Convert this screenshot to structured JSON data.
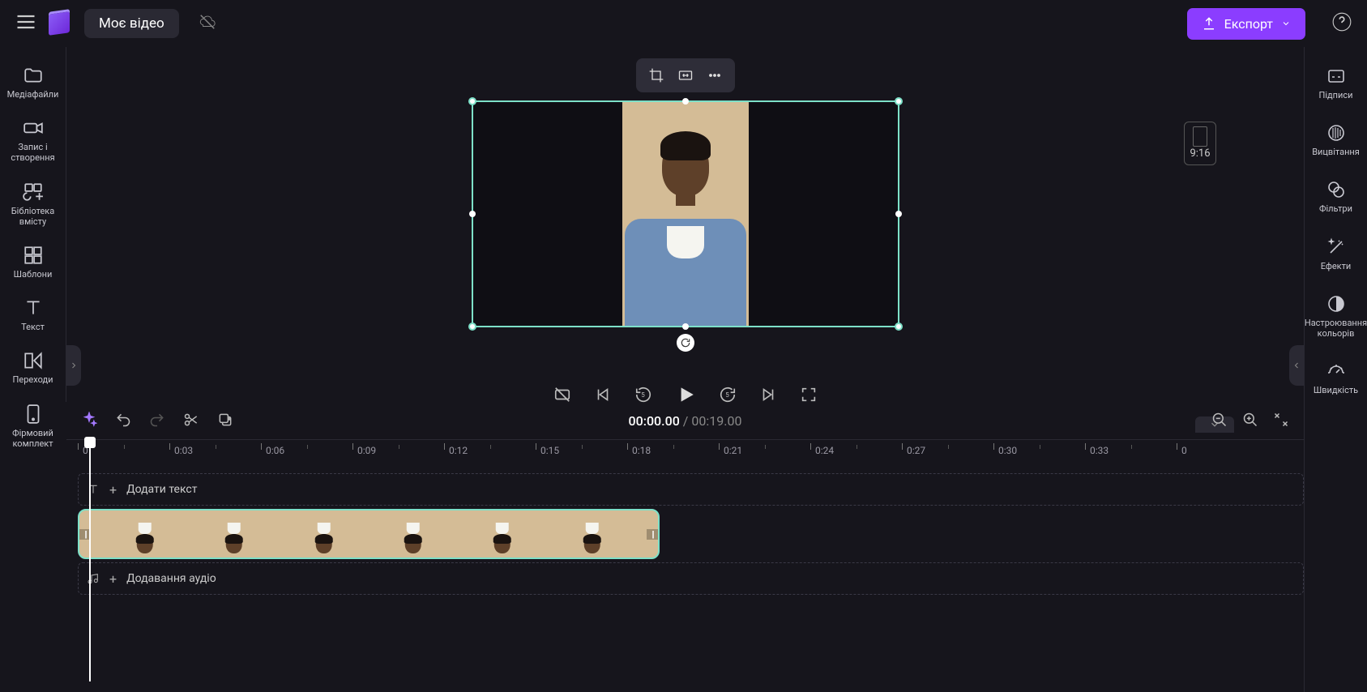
{
  "header": {
    "project_title": "Моє відео",
    "export_label": "Експорт"
  },
  "left_sidebar": {
    "media": "Медіафайли",
    "record": "Запис і створення",
    "library": "Бібліотека вмісту",
    "templates": "Шаблони",
    "text": "Текст",
    "transitions": "Переходи",
    "brandkit": "Фірмовий комплект"
  },
  "right_sidebar": {
    "captions": "Підписи",
    "fade": "Вицвітання",
    "filters": "Фільтри",
    "effects": "Ефекти",
    "color": "Настроювання кольорів",
    "speed": "Швидкість"
  },
  "preview": {
    "aspect_label": "9:16"
  },
  "timecode": {
    "current": "00:00.00",
    "duration": "00:19.00"
  },
  "ruler": {
    "ticks": [
      "0",
      "0:03",
      "0:06",
      "0:09",
      "0:12",
      "0:15",
      "0:18",
      "0:21",
      "0:24",
      "0:27",
      "0:30",
      "0:33",
      "0"
    ]
  },
  "tracks": {
    "text_placeholder": "Додати текст",
    "audio_placeholder": "Додавання аудіо"
  }
}
